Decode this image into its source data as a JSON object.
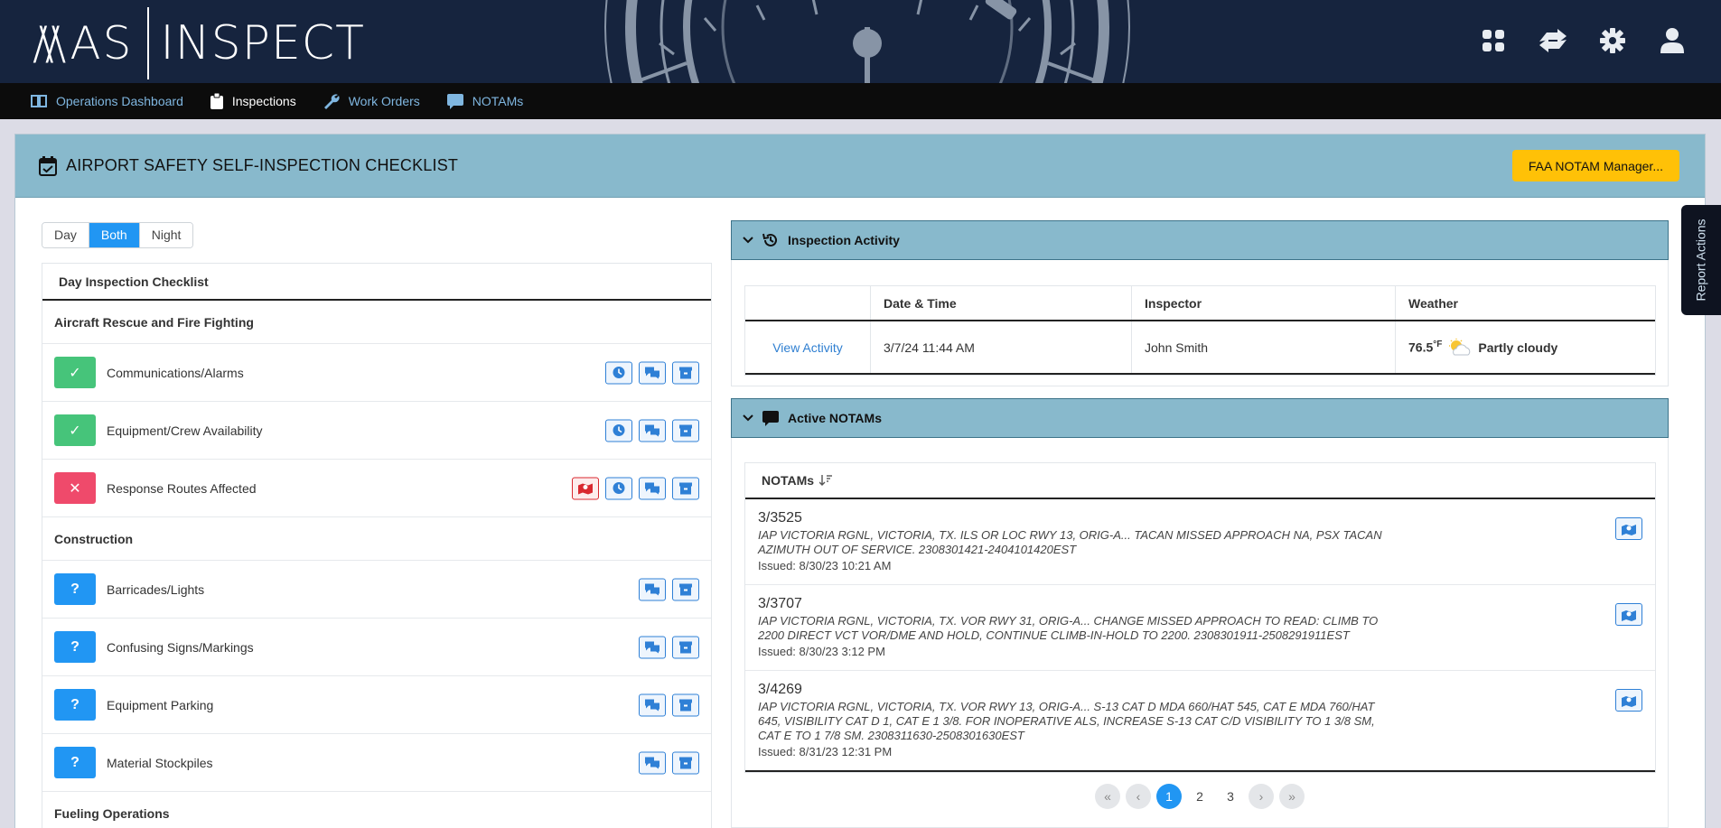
{
  "header": {
    "logo_left": "MAS",
    "logo_right": "INSPECT",
    "icons": [
      "grid-icon",
      "transfer-icon",
      "gear-icon",
      "user-icon"
    ]
  },
  "nav": {
    "items": [
      {
        "label": "Operations Dashboard",
        "icon": "book-icon"
      },
      {
        "label": "Inspections",
        "icon": "clipboard-icon",
        "active": true
      },
      {
        "label": "Work Orders",
        "icon": "wrench-icon"
      },
      {
        "label": "NOTAMs",
        "icon": "chat-icon"
      }
    ]
  },
  "page": {
    "title": "AIRPORT SAFETY SELF-INSPECTION CHECKLIST",
    "faa_button": "FAA NOTAM Manager...",
    "side_tab": "Report Actions"
  },
  "toggle": {
    "day": "Day",
    "both": "Both",
    "night": "Night",
    "selected": "Both"
  },
  "checklist": {
    "title": "Day Inspection Checklist",
    "sections": {
      "arff": "Aircraft Rescue and Fire Fighting",
      "construction": "Construction",
      "fueling": "Fueling Operations"
    },
    "items": {
      "comms": "Communications/Alarms",
      "equipment_crew": "Equipment/Crew Availability",
      "response_routes": "Response Routes Affected",
      "barricades": "Barricades/Lights",
      "confusing_signs": "Confusing Signs/Markings",
      "equipment_parking": "Equipment Parking",
      "material_stockpiles": "Material Stockpiles"
    },
    "status_glyphs": {
      "ok": "✓",
      "bad": "✕",
      "unknown": "?"
    }
  },
  "activity": {
    "title": "Inspection Activity",
    "columns": {
      "date": "Date & Time",
      "inspector": "Inspector",
      "weather": "Weather"
    },
    "row": {
      "link": "View Activity",
      "date": "3/7/24 11:44 AM",
      "inspector": "John Smith",
      "temp": "76.5",
      "temp_unit": "°F",
      "condition": "Partly cloudy"
    }
  },
  "notams": {
    "title": "Active NOTAMs",
    "list_header": "NOTAMs",
    "items": [
      {
        "id": "3/3525",
        "text": "IAP VICTORIA RGNL, VICTORIA, TX. ILS OR LOC RWY 13, ORIG-A... TACAN MISSED APPROACH NA, PSX TACAN AZIMUTH OUT OF SERVICE. 2308301421-2404101420EST",
        "issued": "Issued: 8/30/23 10:21 AM"
      },
      {
        "id": "3/3707",
        "text": "IAP VICTORIA RGNL, VICTORIA, TX. VOR RWY 31, ORIG-A... CHANGE MISSED APPROACH TO READ: CLIMB TO 2200 DIRECT VCT VOR/DME AND HOLD, CONTINUE CLIMB-IN-HOLD TO 2200. 2308301911-2508291911EST",
        "issued": "Issued: 8/30/23 3:12 PM"
      },
      {
        "id": "3/4269",
        "text": "IAP VICTORIA RGNL, VICTORIA, TX. VOR RWY 13, ORIG-A... S-13 CAT D MDA 660/HAT 545, CAT E MDA 760/HAT 645, VISIBILITY CAT D 1, CAT E 1 3/8. FOR INOPERATIVE ALS, INCREASE S-13 CAT C/D VISIBILITY TO 1 3/8 SM, CAT E TO 1 7/8 SM. 2308311630-2508301630EST",
        "issued": "Issued: 8/31/23 12:31 PM"
      }
    ],
    "pagination": {
      "pages": [
        "1",
        "2",
        "3"
      ],
      "current": "1"
    }
  },
  "colors": {
    "accent": "#2196f3",
    "ok": "#46c47a",
    "bad": "#ef4a6b",
    "header_band": "#88b9cc",
    "faa_button": "#ffc107"
  }
}
